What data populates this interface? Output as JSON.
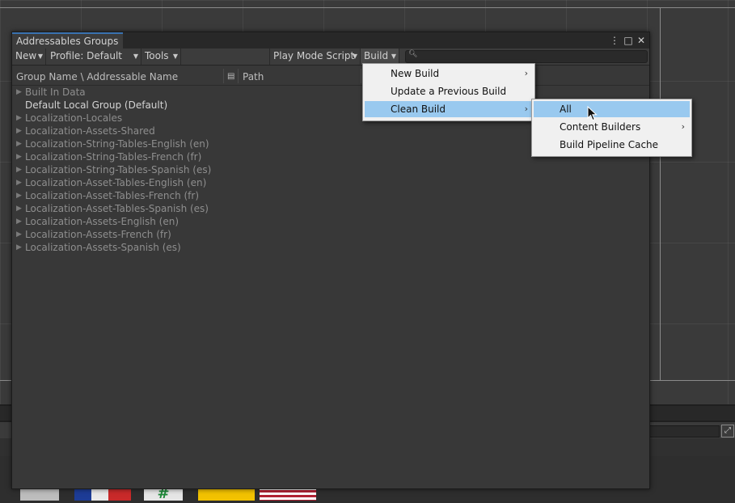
{
  "window": {
    "tab_title": "Addressables Groups"
  },
  "toolbar": {
    "new_label": "New",
    "profile_label": "Profile: Default",
    "tools_label": "Tools",
    "play_mode_label": "Play Mode Script",
    "build_label": "Build",
    "search_placeholder": ""
  },
  "columns": {
    "group_name": "Group Name \\ Addressable Name",
    "path": "Path"
  },
  "groups": [
    {
      "name": "Built In Data",
      "expandable": true
    },
    {
      "name": "Default Local Group (Default)",
      "expandable": false
    },
    {
      "name": "Localization-Locales",
      "expandable": true
    },
    {
      "name": "Localization-Assets-Shared",
      "expandable": true
    },
    {
      "name": "Localization-String-Tables-English (en)",
      "expandable": true
    },
    {
      "name": "Localization-String-Tables-French (fr)",
      "expandable": true
    },
    {
      "name": "Localization-String-Tables-Spanish (es)",
      "expandable": true
    },
    {
      "name": "Localization-Asset-Tables-English (en)",
      "expandable": true
    },
    {
      "name": "Localization-Asset-Tables-French (fr)",
      "expandable": true
    },
    {
      "name": "Localization-Asset-Tables-Spanish (es)",
      "expandable": true
    },
    {
      "name": "Localization-Assets-English (en)",
      "expandable": true
    },
    {
      "name": "Localization-Assets-French (fr)",
      "expandable": true
    },
    {
      "name": "Localization-Assets-Spanish (es)",
      "expandable": true
    }
  ],
  "build_menu": {
    "items": [
      "New Build",
      "Update a Previous Build",
      "Clean Build"
    ],
    "selected": "Clean Build"
  },
  "clean_build_menu": {
    "items": [
      "All",
      "Content Builders",
      "Build Pipeline Cache"
    ],
    "selected": "All"
  },
  "colors": {
    "menu_highlight": "#99c9ef",
    "tab_accent": "#3a72b0"
  }
}
